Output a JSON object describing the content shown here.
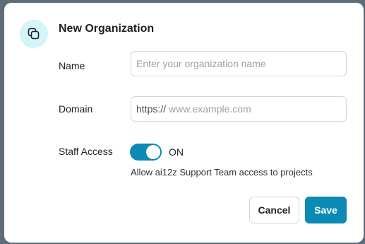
{
  "modal": {
    "title": "New Organization",
    "icon": "copy-icon"
  },
  "form": {
    "name": {
      "label": "Name",
      "value": "",
      "placeholder": "Enter your organization name"
    },
    "domain": {
      "label": "Domain",
      "prefix": "https://",
      "value": "",
      "placeholder": "www.example.com"
    },
    "staff_access": {
      "label": "Staff Access",
      "enabled": true,
      "state_text": "ON",
      "description": "Allow ai12z Support Team access to projects"
    }
  },
  "actions": {
    "cancel_label": "Cancel",
    "save_label": "Save"
  },
  "colors": {
    "accent": "#0a8ab4",
    "icon_bg": "#d3f4f8",
    "backdrop": "#5f6b78"
  }
}
